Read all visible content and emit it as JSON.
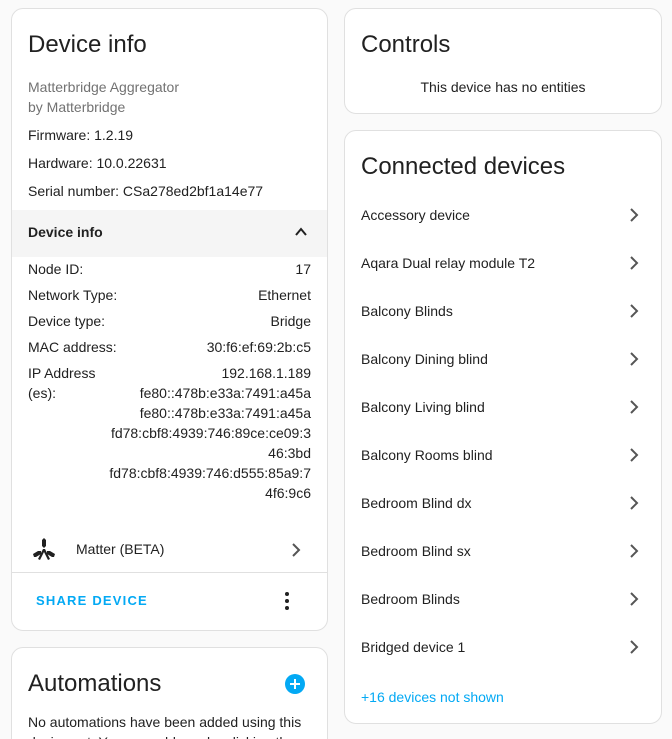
{
  "device_info": {
    "title": "Device info",
    "model": "Matterbridge Aggregator",
    "manufacturer": "by Matterbridge",
    "firmware": "Firmware: 1.2.19",
    "hardware": "Hardware: 10.0.22631",
    "serial": "Serial number: CSa278ed2bf1a14e77",
    "expander_label": "Device info",
    "fields": {
      "node_id_label": "Node ID:",
      "node_id": "17",
      "network_type_label": "Network Type:",
      "network_type": "Ethernet",
      "device_type_label": "Device type:",
      "device_type": "Bridge",
      "mac_label": "MAC address:",
      "mac": "30:f6:ef:69:2b:c5",
      "ip_label_1": "IP Address",
      "ip_label_2": "(es):",
      "ip_lines": [
        "192.168.1.189",
        "fe80::478b:e33a:7491:a45a",
        "fe80::478b:e33a:7491:a45a",
        "fd78:cbf8:4939:746:89ce:ce09:3",
        "46:3bd",
        "fd78:cbf8:4939:746:d555:85a9:7",
        "4f6:9c6"
      ]
    },
    "integration_label": "Matter (BETA)",
    "share_label": "SHARE DEVICE"
  },
  "automations": {
    "title": "Automations",
    "description": "No automations have been added using this device yet. You can add one by clicking the + button above."
  },
  "controls": {
    "title": "Controls",
    "empty_text": "This device has no entities"
  },
  "connected": {
    "title": "Connected devices",
    "items": [
      "Accessory device",
      "Aqara Dual relay module T2",
      "Balcony Blinds",
      "Balcony Dining blind",
      "Balcony Living blind",
      "Balcony Rooms blind",
      "Bedroom Blind dx",
      "Bedroom Blind sx",
      "Bedroom Blinds",
      "Bridged device 1"
    ],
    "more_label": "+16 devices not shown"
  },
  "colors": {
    "accent": "#03a9f4",
    "text": "#212121",
    "muted": "#727272",
    "expander_bg": "#f5f5f5"
  }
}
